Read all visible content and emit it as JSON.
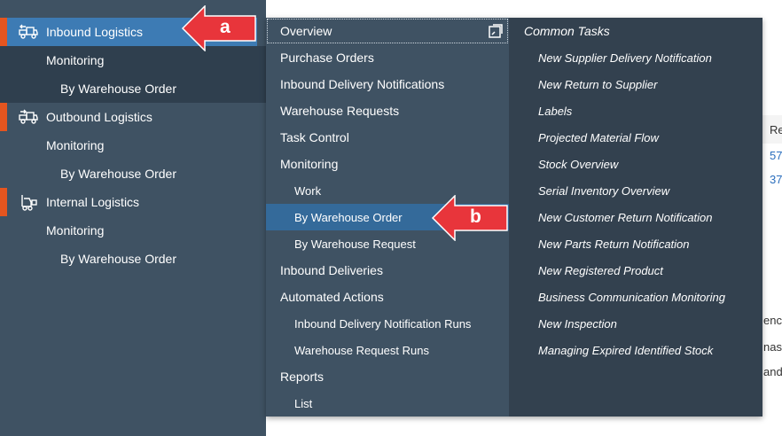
{
  "sidebar": {
    "items": [
      {
        "label": "Inbound Logistics",
        "icon": "truck-inbound-icon"
      },
      {
        "label": "Monitoring"
      },
      {
        "label": "By Warehouse Order"
      },
      {
        "label": "Outbound Logistics",
        "icon": "truck-outbound-icon"
      },
      {
        "label": "Monitoring"
      },
      {
        "label": "By Warehouse Order"
      },
      {
        "label": "Internal Logistics",
        "icon": "forklift-icon"
      },
      {
        "label": "Monitoring"
      },
      {
        "label": "By Warehouse Order"
      }
    ]
  },
  "menu": {
    "items": [
      {
        "label": "Overview"
      },
      {
        "label": "Purchase Orders"
      },
      {
        "label": "Inbound Delivery Notifications"
      },
      {
        "label": "Warehouse Requests"
      },
      {
        "label": "Task Control"
      },
      {
        "label": "Monitoring"
      },
      {
        "label": "Work"
      },
      {
        "label": "By Warehouse Order"
      },
      {
        "label": "By Warehouse Request"
      },
      {
        "label": "Inbound Deliveries"
      },
      {
        "label": "Automated Actions"
      },
      {
        "label": "Inbound Delivery Notification Runs"
      },
      {
        "label": "Warehouse Request Runs"
      },
      {
        "label": "Reports"
      },
      {
        "label": "List"
      }
    ]
  },
  "common_tasks": {
    "heading": "Common Tasks",
    "items": [
      "New Supplier Delivery Notification",
      "New Return to Supplier",
      "Labels",
      "Projected Material Flow",
      "Stock Overview",
      "Serial Inventory Overview",
      "New Customer Return Notification",
      "New Parts Return Notification",
      "New Registered Product",
      "Business Communication Monitoring",
      "New Inspection",
      "Managing Expired Identified Stock"
    ]
  },
  "background": {
    "col_header": "Re",
    "link1": "57",
    "link2": "37",
    "text1": "enc",
    "text2": "nase",
    "text3": "and"
  },
  "callouts": {
    "a": "a",
    "b": "b"
  },
  "colors": {
    "accent": "#e5551f",
    "active": "#3d7bb4",
    "callout": "#e8353b"
  }
}
